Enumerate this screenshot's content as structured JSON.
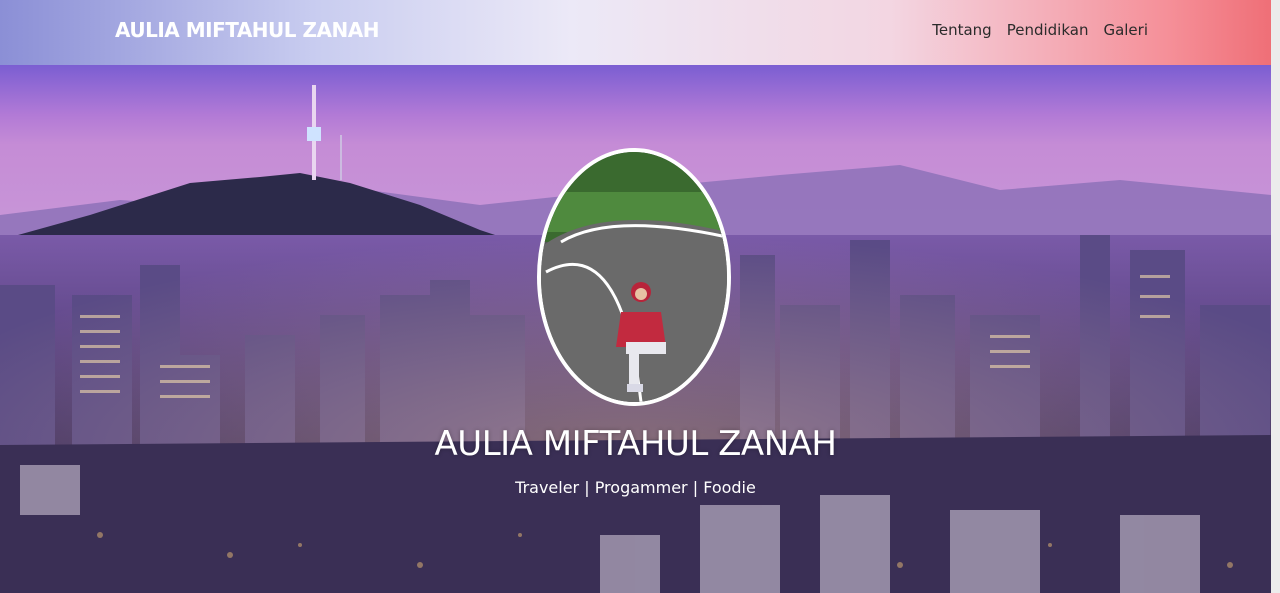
{
  "navbar": {
    "brand": "AULIA MIFTAHUL ZANAH",
    "links": [
      "Tentang",
      "Pendidikan",
      "Galeri"
    ]
  },
  "hero": {
    "name": "AULIA MIFTAHUL ZANAH",
    "tagline": "Traveler | Progammer | Foodie",
    "background_image": "night city skyline with mountain and tower",
    "profile_image": "person in red hoodie sitting on a road"
  },
  "colors": {
    "navbar_gradient_start": "#8b8fd6",
    "navbar_gradient_end": "#ef6f77",
    "text_on_hero": "#ffffff"
  }
}
